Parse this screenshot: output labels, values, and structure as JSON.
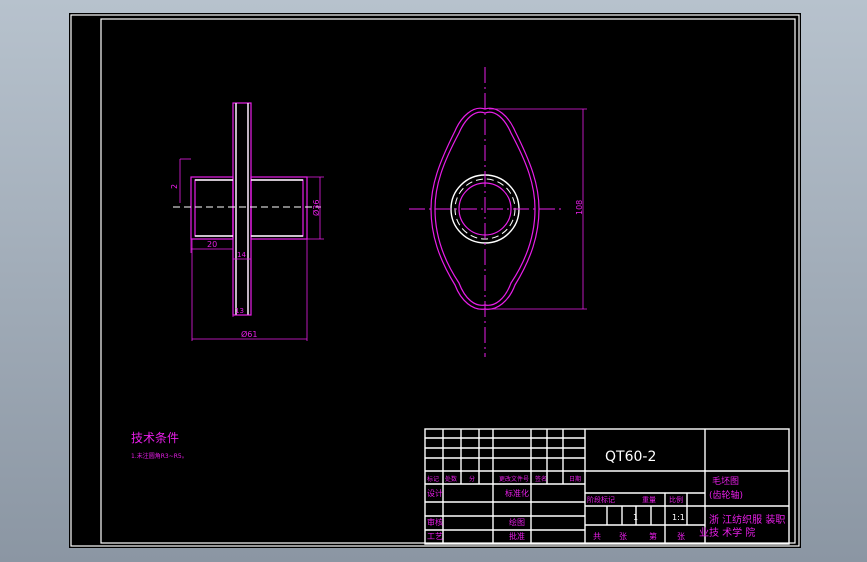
{
  "drawing": {
    "code": "QT60-2",
    "part_name": "毛坯图",
    "part_name_sub": "(齿轮轴)",
    "organization": "浙江纺织服装职业技术学院",
    "organization_line1": "浙 江纺织服 装职",
    "organization_line2": "业技 术学 院",
    "scale": "1:1",
    "quantity": "1"
  },
  "tech_req": {
    "title": "技术条件",
    "line1": "1.未注圆角R3~R5。"
  },
  "dimensions": {
    "d1": "2",
    "d2": "Ø36",
    "d3": "20",
    "d4": "14",
    "d5": "13",
    "d6": "Ø61",
    "d7": "108"
  },
  "title_block": {
    "col_mark": "标记",
    "col_count": "处数",
    "col_zone": "分",
    "col_change": "更改文件号",
    "col_sign": "签名",
    "col_date": "日期",
    "design": "设计",
    "standard": "标准化",
    "check": "审核",
    "draw": "绘图",
    "process": "工艺",
    "approve": "批准",
    "stage": "阶段标记",
    "weight": "重量",
    "ratio": "比例",
    "total": "共",
    "sheet": "张",
    "page": "第",
    "page2": "张"
  }
}
